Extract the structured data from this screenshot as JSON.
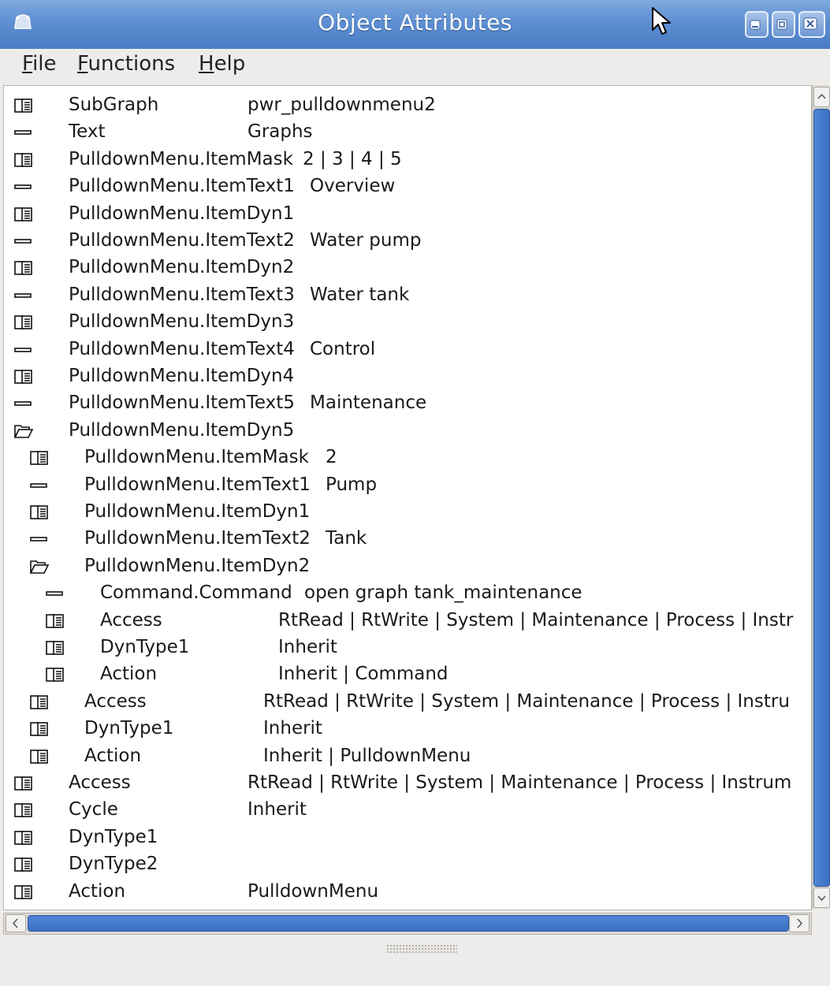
{
  "window": {
    "title": "Object Attributes"
  },
  "menu": [
    {
      "mnemonic": "F",
      "rest": "ile"
    },
    {
      "mnemonic": "F",
      "rest": "unctions"
    },
    {
      "mnemonic": "H",
      "rest": "elp"
    }
  ],
  "icons": {
    "attribute_group": "folder-closed-icon",
    "attribute": "attribute-dash-icon",
    "expanded_group": "folder-open-icon"
  },
  "rows": [
    {
      "icon": "folder",
      "level": 0,
      "name": "SubGraph",
      "value": "pwr_pulldownmenu2"
    },
    {
      "icon": "dash",
      "level": 0,
      "name": "Text",
      "value": "Graphs"
    },
    {
      "icon": "folder",
      "level": 0,
      "name": "PulldownMenu.ItemMask",
      "value": "2 | 3 | 4 | 5"
    },
    {
      "icon": "dash",
      "level": 0,
      "name": "PulldownMenu.ItemText1",
      "value": "Overview"
    },
    {
      "icon": "folder",
      "level": 0,
      "name": "PulldownMenu.ItemDyn1",
      "value": ""
    },
    {
      "icon": "dash",
      "level": 0,
      "name": "PulldownMenu.ItemText2",
      "value": "Water pump"
    },
    {
      "icon": "folder",
      "level": 0,
      "name": "PulldownMenu.ItemDyn2",
      "value": ""
    },
    {
      "icon": "dash",
      "level": 0,
      "name": "PulldownMenu.ItemText3",
      "value": "Water tank"
    },
    {
      "icon": "folder",
      "level": 0,
      "name": "PulldownMenu.ItemDyn3",
      "value": ""
    },
    {
      "icon": "dash",
      "level": 0,
      "name": "PulldownMenu.ItemText4",
      "value": "Control"
    },
    {
      "icon": "folder",
      "level": 0,
      "name": "PulldownMenu.ItemDyn4",
      "value": ""
    },
    {
      "icon": "dash",
      "level": 0,
      "name": "PulldownMenu.ItemText5",
      "value": "Maintenance"
    },
    {
      "icon": "open",
      "level": 0,
      "name": "PulldownMenu.ItemDyn5",
      "value": ""
    },
    {
      "icon": "folder",
      "level": 1,
      "name": "PulldownMenu.ItemMask",
      "value": "2"
    },
    {
      "icon": "dash",
      "level": 1,
      "name": "PulldownMenu.ItemText1",
      "value": "Pump"
    },
    {
      "icon": "folder",
      "level": 1,
      "name": "PulldownMenu.ItemDyn1",
      "value": ""
    },
    {
      "icon": "dash",
      "level": 1,
      "name": "PulldownMenu.ItemText2",
      "value": "Tank"
    },
    {
      "icon": "open",
      "level": 1,
      "name": "PulldownMenu.ItemDyn2",
      "value": ""
    },
    {
      "icon": "dash",
      "level": 2,
      "name": "Command.Command",
      "value": "open graph tank_maintenance"
    },
    {
      "icon": "folder",
      "level": 2,
      "name": "Access",
      "value": "RtRead | RtWrite | System | Maintenance | Process | Instr"
    },
    {
      "icon": "folder",
      "level": 2,
      "name": "DynType1",
      "value": "Inherit"
    },
    {
      "icon": "folder",
      "level": 2,
      "name": "Action",
      "value": "Inherit | Command"
    },
    {
      "icon": "folder",
      "level": 1,
      "name": "Access",
      "value": "RtRead | RtWrite | System | Maintenance | Process | Instru"
    },
    {
      "icon": "folder",
      "level": 1,
      "name": "DynType1",
      "value": "Inherit"
    },
    {
      "icon": "folder",
      "level": 1,
      "name": "Action",
      "value": "Inherit | PulldownMenu"
    },
    {
      "icon": "folder",
      "level": 0,
      "name": "Access",
      "value": "RtRead | RtWrite | System | Maintenance | Process | Instrum"
    },
    {
      "icon": "folder",
      "level": 0,
      "name": "Cycle",
      "value": "Inherit"
    },
    {
      "icon": "folder",
      "level": 0,
      "name": "DynType1",
      "value": ""
    },
    {
      "icon": "folder",
      "level": 0,
      "name": "DynType2",
      "value": ""
    },
    {
      "icon": "folder",
      "level": 0,
      "name": "Action",
      "value": "PulldownMenu"
    }
  ]
}
